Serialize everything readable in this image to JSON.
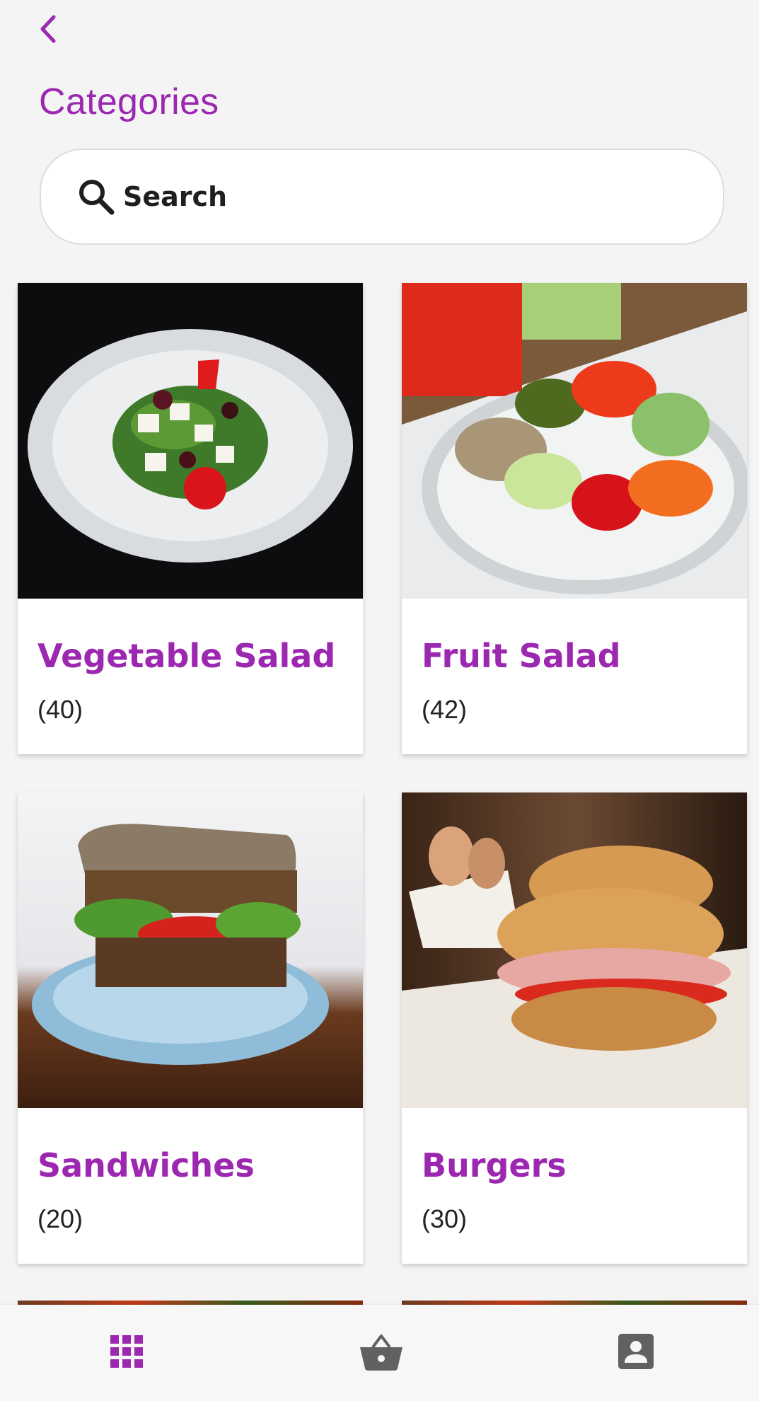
{
  "header": {
    "title": "Categories"
  },
  "search": {
    "placeholder": "Search"
  },
  "categories": [
    {
      "name": "Vegetable Salad",
      "count": "(40)"
    },
    {
      "name": "Fruit Salad",
      "count": "(42)"
    },
    {
      "name": "Sandwiches",
      "count": "(20)"
    },
    {
      "name": "Burgers",
      "count": "(30)"
    }
  ],
  "bottom_nav": [
    {
      "icon": "grid-icon",
      "active": true
    },
    {
      "icon": "basket-icon",
      "active": false
    },
    {
      "icon": "account-icon",
      "active": false
    }
  ],
  "colors": {
    "accent": "#9c27b0",
    "icon_inactive": "#616161",
    "background": "#f4f4f4"
  }
}
